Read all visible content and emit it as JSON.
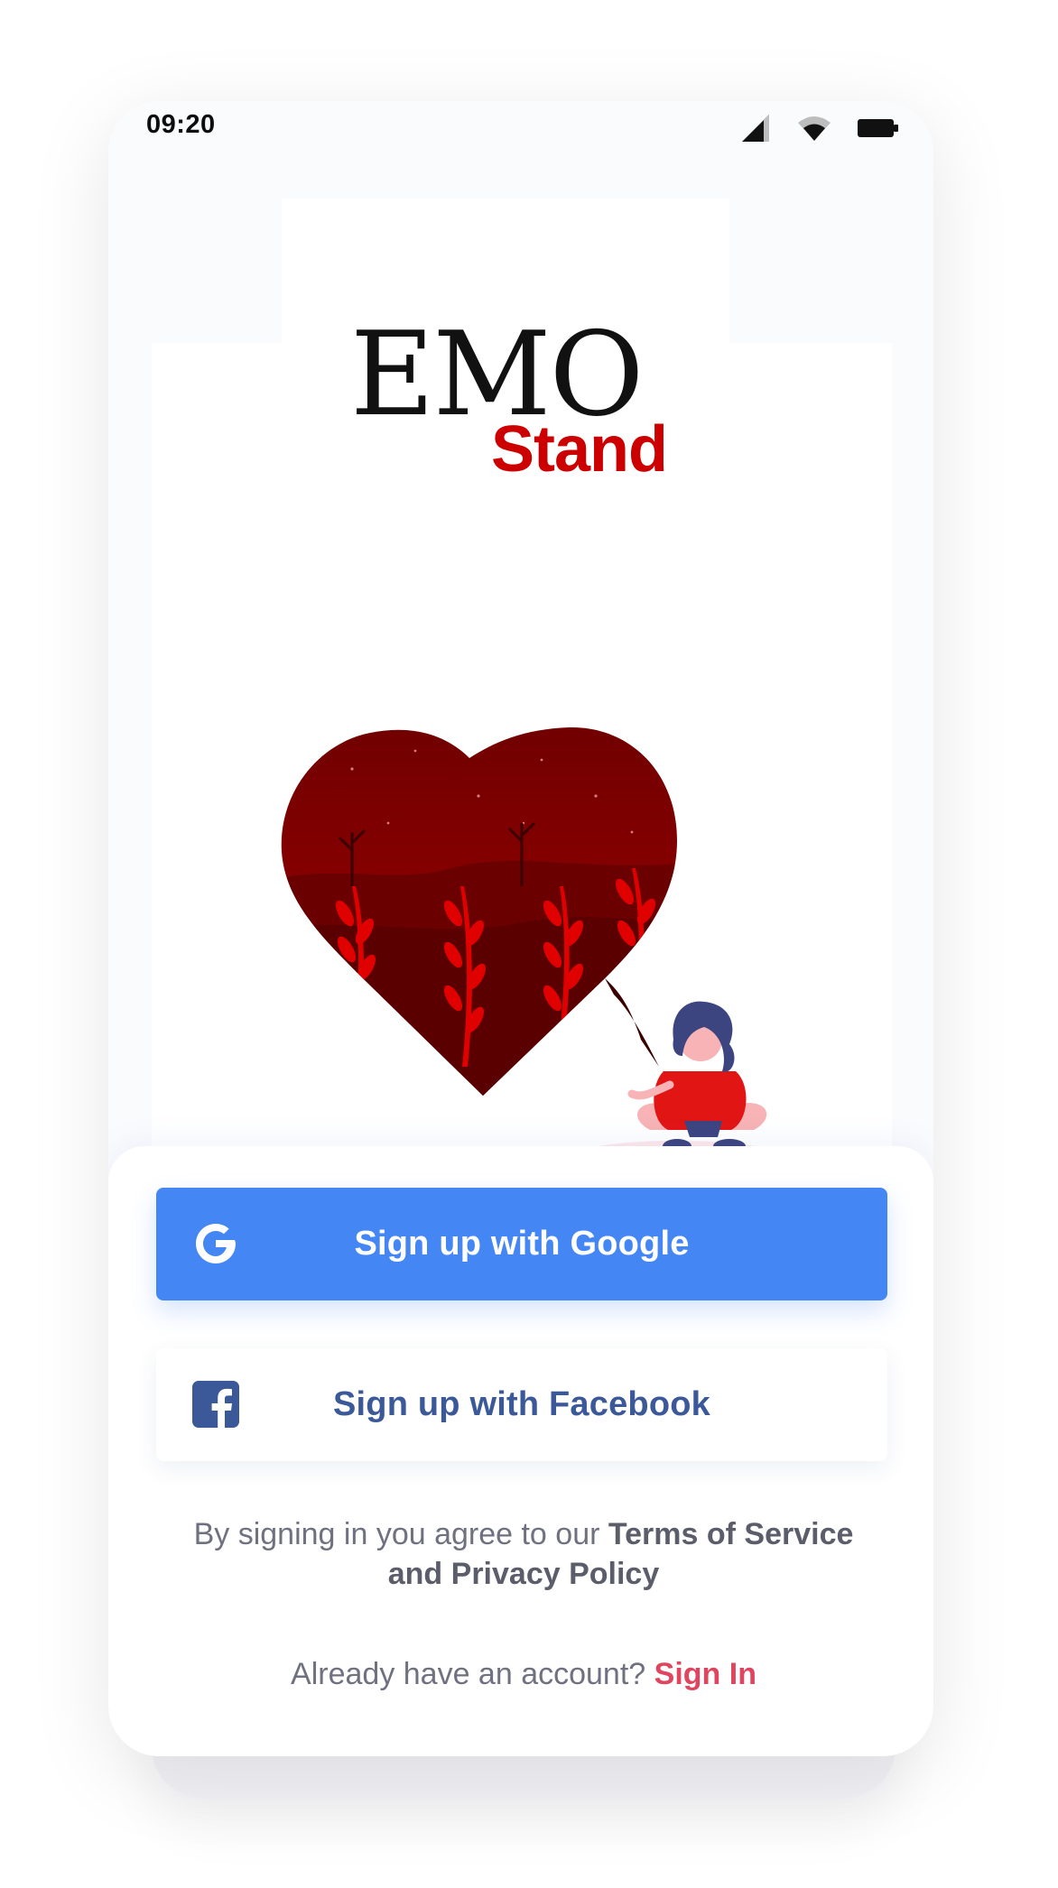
{
  "status_bar": {
    "time": "09:20",
    "icons": [
      "signal-icon",
      "wifi-icon",
      "battery-icon"
    ]
  },
  "logo": {
    "line1": "EMO",
    "line2": "Stand",
    "accent_color": "#cc0000"
  },
  "illustration": {
    "subject": "heart-with-wheat-field-and-sitting-woman"
  },
  "buttons": {
    "google": {
      "label": "Sign up with Google",
      "icon": "google-icon",
      "color": "#4486f4"
    },
    "facebook": {
      "label": "Sign up with Facebook",
      "icon": "facebook-icon",
      "color": "#3b5998"
    }
  },
  "terms": {
    "prefix": "By signing in you agree to our ",
    "link": "Terms of Service and Privacy Policy"
  },
  "signin": {
    "prompt": "Already have an account? ",
    "link": "Sign In",
    "link_color": "#e0455f"
  }
}
